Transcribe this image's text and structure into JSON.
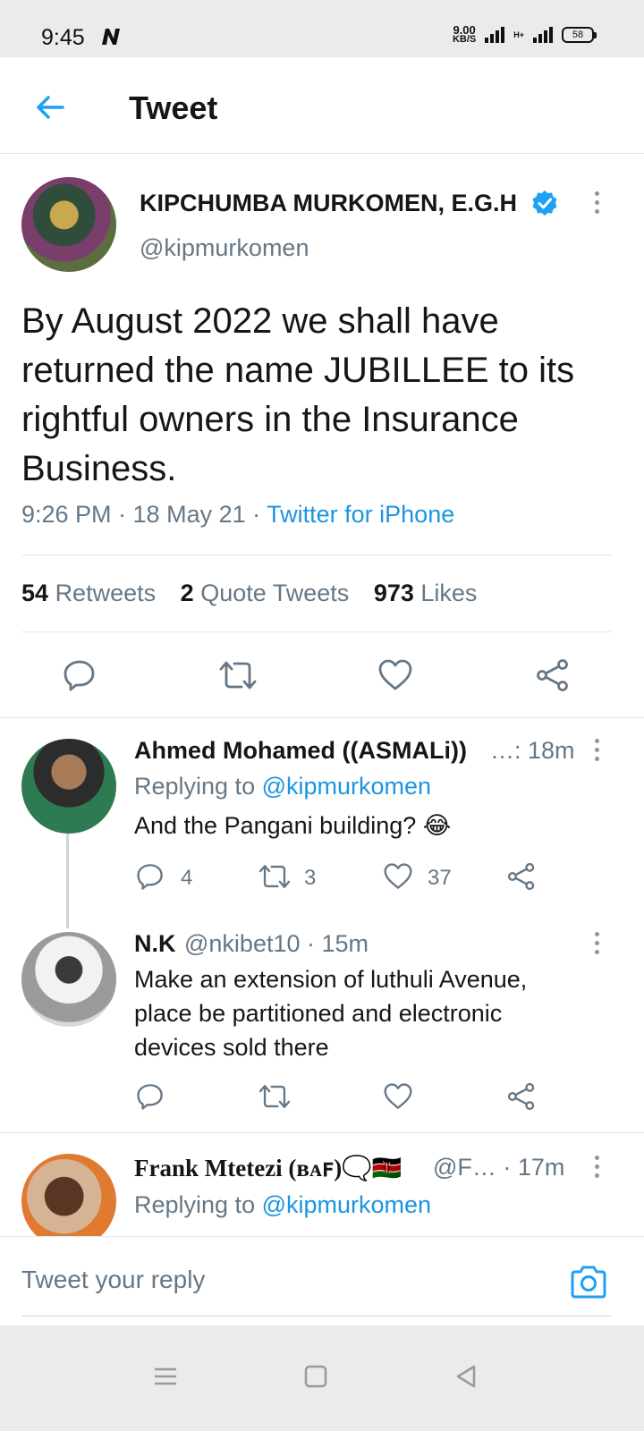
{
  "status_bar": {
    "time": "9:45",
    "speed_value": "9.00",
    "speed_unit": "KB/S",
    "network": "H+",
    "battery": "58"
  },
  "header": {
    "title": "Tweet"
  },
  "tweet": {
    "author_name": "KIPCHUMBA MURKOMEN, E.G.H",
    "handle": "@kipmurkomen",
    "text": "By August 2022 we shall have returned the name JUBILLEE to its rightful owners in the Insurance Business.",
    "time": "9:26 PM · 18 May 21 · ",
    "source": "Twitter for iPhone",
    "retweets_count": "54",
    "retweets_label": "Retweets",
    "quotes_count": "2",
    "quotes_label": "Quote Tweets",
    "likes_count": "973",
    "likes_label": "Likes"
  },
  "replies": [
    {
      "name": "Ahmed Mohamed ((ASMALi))",
      "meta": "…: 18m",
      "replying_prefix": "Replying to ",
      "replying_to": "@kipmurkomen",
      "text": "And the Pangani building? 😂",
      "reply_count": "4",
      "retweet_count": "3",
      "like_count": "37"
    },
    {
      "name": "N.K",
      "meta": "@nkibet10 · 15m",
      "text": "Make an extension of luthuli Avenue, place be partitioned and electronic devices sold there"
    },
    {
      "name": "Frank Mtetezi (ʙᴀꜰ)🗨️🇰🇪",
      "meta": "@F…  · 17m",
      "replying_prefix": "Replying to ",
      "replying_to": "@kipmurkomen"
    }
  ],
  "composer": {
    "placeholder": "Tweet your reply"
  },
  "colors": {
    "accent": "#1da1f2",
    "link": "#1b95e0",
    "secondary_text": "#657786"
  }
}
